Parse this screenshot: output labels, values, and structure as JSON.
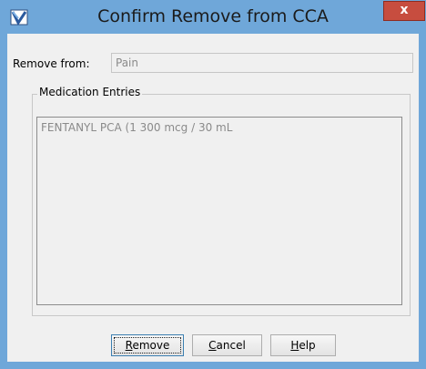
{
  "window": {
    "title": "Confirm Remove from CCA",
    "close_glyph": "x",
    "icon": "checkmark-app-icon"
  },
  "remove_from": {
    "label": "Remove from:",
    "value": "Pain"
  },
  "medication_entries": {
    "group_title": "Medication Entries",
    "items": [
      "FENTANYL PCA (1 300 mcg / 30 mL"
    ]
  },
  "buttons": {
    "remove": {
      "first": "R",
      "rest": "emove"
    },
    "cancel": {
      "first": "C",
      "rest": "ancel"
    },
    "help": {
      "first": "H",
      "rest": "elp"
    }
  },
  "colors": {
    "titlebar": "#6fa7d9",
    "close_button": "#c74d3f",
    "client_bg": "#f0f0f0"
  }
}
